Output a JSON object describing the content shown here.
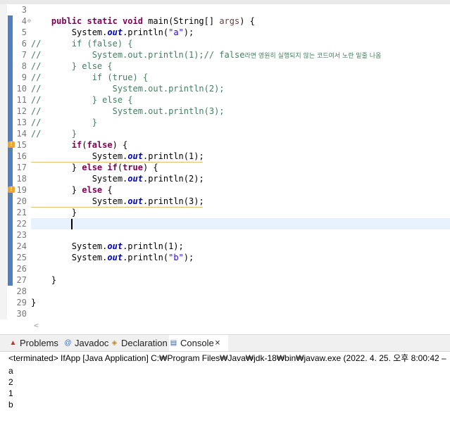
{
  "editor": {
    "line_numbers": [
      "3",
      "4",
      "5",
      "6",
      "7",
      "8",
      "9",
      "10",
      "11",
      "12",
      "13",
      "14",
      "15",
      "16",
      "17",
      "18",
      "19",
      "20",
      "21",
      "22",
      "23",
      "24",
      "25",
      "26",
      "27",
      "28",
      "29",
      "30"
    ],
    "code": {
      "l4_kw": "public static void",
      "l4_rest": " main(String[] ",
      "l4_args": "args",
      "l4_end": ") {",
      "l5_pre": "        System.",
      "l5_out": "out",
      "l5_mid": ".println(",
      "l5_str": "\"a\"",
      "l5_end": ");",
      "l6": "//      if (false) {",
      "l7_pre": "//          System.out.println(1);// false",
      "l7_ko": "라면 영원히 실행되지 않는 코드여서 노란 밑줄 나옴",
      "l8": "//      } else {",
      "l9": "//          if (true) {",
      "l10": "//              System.out.println(2);",
      "l11": "//          } else {",
      "l12": "//              System.out.println(3);",
      "l13": "//          }",
      "l14": "//      }",
      "l15_kw": "if",
      "l15_paren": "(",
      "l15_val": "false",
      "l15_end": ") {",
      "l16_pre": "            System.",
      "l16_out": "out",
      "l16_end": ".println(1);",
      "l17_brace": "        } ",
      "l17_kw1": "else if",
      "l17_paren": "(",
      "l17_val": "true",
      "l17_end": ") {",
      "l18_pre": "            System.",
      "l18_out": "out",
      "l18_end": ".println(2);",
      "l19_brace": "        } ",
      "l19_kw": "else",
      "l19_end": " {",
      "l20_pre": "            System.",
      "l20_out": "out",
      "l20_end": ".println(3);",
      "l21": "        }",
      "l24_pre": "        System.",
      "l24_out": "out",
      "l24_end": ".println(1);",
      "l25_pre": "        System.",
      "l25_out": "out",
      "l25_mid": ".println(",
      "l25_str": "\"b\"",
      "l25_end": ");",
      "l27": "    }",
      "l29": "}"
    },
    "fold_marker": "⊖",
    "warning_marker": "!",
    "scroll_left": "<"
  },
  "panel": {
    "tabs": [
      {
        "label": "Problems",
        "icon": "problems-icon"
      },
      {
        "label": "Javadoc",
        "icon": "javadoc-icon"
      },
      {
        "label": "Declaration",
        "icon": "declaration-icon"
      },
      {
        "label": "Console",
        "icon": "console-icon"
      }
    ],
    "close_glyph": "×",
    "status": "<terminated> IfApp [Java Application] C:₩Program Files₩Java₩jdk-18₩bin₩javaw.exe  (2022. 4. 25. 오후 8:00:42 – ",
    "output": [
      "a",
      "2",
      "1",
      "b"
    ]
  },
  "colors": {
    "keyword": "#7f0055",
    "string": "#2a00ff",
    "static_field": "#0000c0",
    "comment": "#3f7f5f",
    "current_line": "#e8f2fe",
    "ruler_bar": "#4f7fbf"
  }
}
